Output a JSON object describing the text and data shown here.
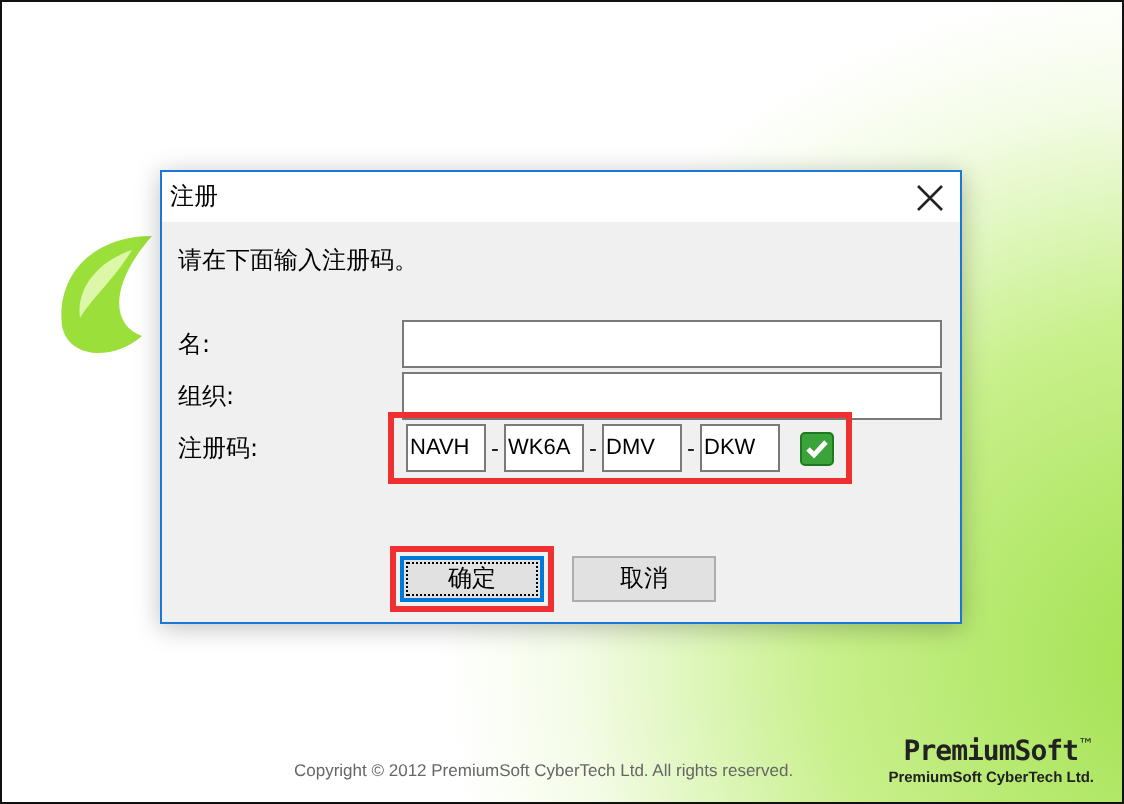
{
  "dialog": {
    "title": "注册",
    "prompt": "请在下面输入注册码。",
    "fields": [
      {
        "label": "名:"
      },
      {
        "label": "组织:"
      }
    ],
    "key": {
      "label": "注册码:",
      "parts": [
        "NAVH",
        "WK6A",
        "DMV",
        "DKW"
      ],
      "separator": "-",
      "valid": true,
      "highlighted": true
    },
    "buttons": [
      {
        "label": "确定",
        "default": true,
        "highlighted": true
      },
      {
        "label": "取消",
        "default": false,
        "highlighted": false
      }
    ]
  },
  "footer": {
    "copyright": "Copyright © 2012 PremiumSoft CyberTech Ltd. All rights reserved.",
    "logo_main": "PremiumSoft",
    "logo_tm": "™",
    "logo_sub": "PremiumSoft CyberTech Ltd."
  }
}
